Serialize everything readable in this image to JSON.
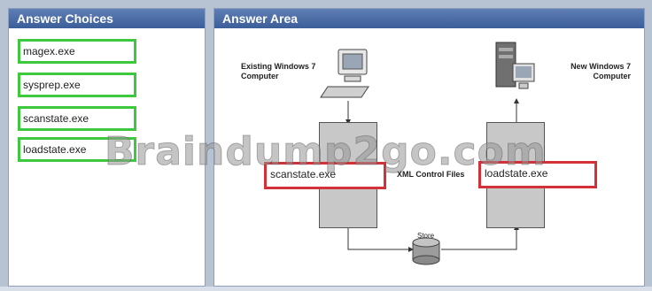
{
  "left_panel": {
    "title": "Answer Choices"
  },
  "right_panel": {
    "title": "Answer Area"
  },
  "choices": [
    "magex.exe",
    "sysprep.exe",
    "scanstate.exe",
    "loadstate.exe"
  ],
  "diagram": {
    "existing_label_1": "Existing Windows 7",
    "existing_label_2": "Computer",
    "new_label_1": "New Windows 7",
    "new_label_2": "Computer",
    "xml_label": "XML Control Files",
    "store_label": "Store",
    "drop_left_value": "scanstate.exe",
    "drop_right_value": "loadstate.exe"
  },
  "watermark": "Braindump2go.com"
}
